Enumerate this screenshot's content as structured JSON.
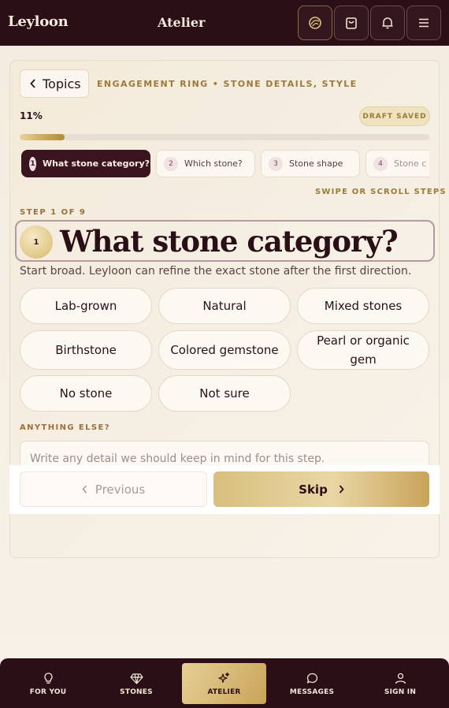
{
  "header": {
    "brand": "Leyloon",
    "section": "Atelier",
    "icons": [
      "leaf-icon",
      "bag-icon",
      "bell-icon",
      "menu-icon"
    ]
  },
  "questionnaire": {
    "topics_label": "Topics",
    "breadcrumb": "ENGAGEMENT RING • STONE DETAILS, STYLE",
    "progress_label": "11%",
    "progress_value": 0.11,
    "draft_status": "DRAFT SAVED",
    "steps": [
      {
        "num": "1",
        "label": "What stone category?"
      },
      {
        "num": "2",
        "label": "Which stone?"
      },
      {
        "num": "3",
        "label": "Stone shape"
      },
      {
        "num": "4",
        "label": "Stone c"
      }
    ],
    "swipe_hint": "SWIPE OR SCROLL STEPS",
    "step_counter": "STEP 1 OF 9",
    "question_num": "1",
    "question": "What stone category?",
    "hint": "Start broad. Leyloon can refine the exact stone after the first direction.",
    "options": [
      "Lab-grown",
      "Natural",
      "Mixed stones",
      "Birthstone",
      "Colored gemstone",
      "Pearl or organic gem",
      "No stone",
      "Not sure"
    ],
    "anything_label": "ANYTHING ELSE?",
    "anything_placeholder": "Write any detail we should keep in mind for this step.",
    "previous_label": "Previous",
    "skip_label": "Skip"
  },
  "bottom_nav": [
    {
      "label": "FOR YOU",
      "icon": "lightbulb-icon"
    },
    {
      "label": "STONES",
      "icon": "diamond-icon"
    },
    {
      "label": "ATELIER",
      "icon": "sparkle-icon"
    },
    {
      "label": "MESSAGES",
      "icon": "chat-icon"
    },
    {
      "label": "SIGN IN",
      "icon": "user-icon"
    }
  ]
}
